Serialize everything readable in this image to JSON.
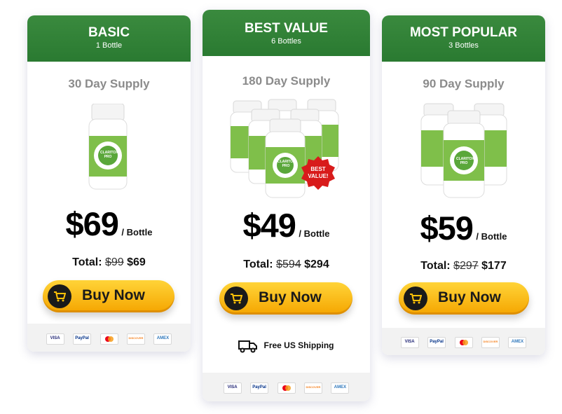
{
  "cards": [
    {
      "title": "BASIC",
      "bottles_label": "1 Bottle",
      "supply": "30 Day Supply",
      "price": "$69",
      "per": "/ Bottle",
      "total_label": "Total:",
      "total_old": "$99",
      "total_new": "$69",
      "buy_label": "Buy Now"
    },
    {
      "title": "BEST VALUE",
      "bottles_label": "6 Bottles",
      "supply": "180 Day Supply",
      "price": "$49",
      "per": "/ Bottle",
      "total_label": "Total:",
      "total_old": "$594",
      "total_new": "$294",
      "buy_label": "Buy Now",
      "badge": "BEST VALUE!",
      "shipping": "Free US Shipping"
    },
    {
      "title": "MOST POPULAR",
      "bottles_label": "3 Bottles",
      "supply": "90 Day Supply",
      "price": "$59",
      "per": "/ Bottle",
      "total_label": "Total:",
      "total_old": "$297",
      "total_new": "$177",
      "buy_label": "Buy Now"
    }
  ],
  "product_name": "CLARITOX PRO",
  "payments": [
    "VISA",
    "PayPal",
    "MC",
    "DISCOVER",
    "AMEX"
  ],
  "colors": {
    "header_green": "#2e7d32",
    "button_yellow": "#ffc107",
    "badge_red": "#d81b1b"
  }
}
